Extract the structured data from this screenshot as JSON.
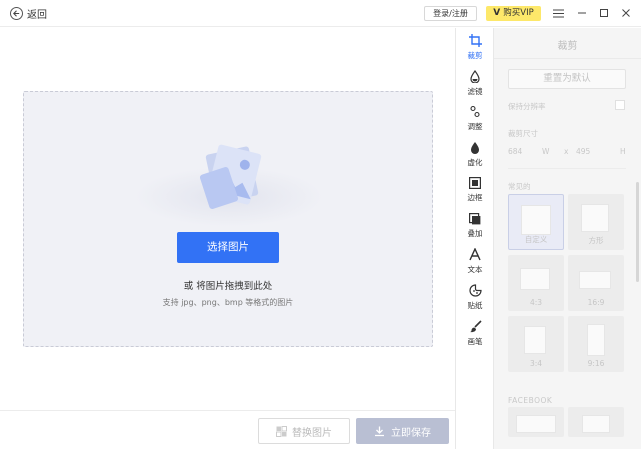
{
  "header": {
    "back_label": "返回",
    "login_label": "登录/注册",
    "vip_label": "购买VIP",
    "vip_badge": "V"
  },
  "dropzone": {
    "choose_label": "选择图片",
    "hint": "或 将图片拖拽到此处",
    "formats": "支持 jpg、png、bmp 等格式的图片"
  },
  "footer": {
    "replace_label": "替换图片",
    "save_label": "立即保存"
  },
  "tools": [
    {
      "id": "crop",
      "label": "裁剪",
      "icon": "crop-icon",
      "active": true
    },
    {
      "id": "filter",
      "label": "滤镜",
      "icon": "filter-drop-icon",
      "active": false
    },
    {
      "id": "adjust",
      "label": "调整",
      "icon": "adjust-icon",
      "active": false
    },
    {
      "id": "blur",
      "label": "虚化",
      "icon": "blur-drop-icon",
      "active": false
    },
    {
      "id": "border",
      "label": "边框",
      "icon": "border-icon",
      "active": false
    },
    {
      "id": "overlay",
      "label": "叠加",
      "icon": "overlay-icon",
      "active": false
    },
    {
      "id": "text",
      "label": "文本",
      "icon": "text-icon",
      "active": false
    },
    {
      "id": "sticker",
      "label": "贴纸",
      "icon": "sticker-icon",
      "active": false
    },
    {
      "id": "brush",
      "label": "画笔",
      "icon": "brush-icon",
      "active": false
    }
  ],
  "panel": {
    "title": "裁剪",
    "reset_label": "重置为默认",
    "lock_ratio_label": "保持分辨率",
    "size_label": "裁剪尺寸",
    "width_value": "684",
    "width_unit": "W",
    "times": "x",
    "height_value": "495",
    "height_unit": "H",
    "common_label": "常见的",
    "presets": [
      {
        "label": "自定义",
        "selected": true
      },
      {
        "label": "方形",
        "selected": false
      },
      {
        "label": "4:3",
        "selected": false
      },
      {
        "label": "16:9",
        "selected": false
      },
      {
        "label": "3:4",
        "selected": false
      },
      {
        "label": "9:16",
        "selected": false
      }
    ],
    "facebook_label": "FACEBOOK"
  },
  "colors": {
    "accent": "#3272f5",
    "vip_bg": "#fde86a",
    "save_disabled": "#b9bfd3"
  }
}
